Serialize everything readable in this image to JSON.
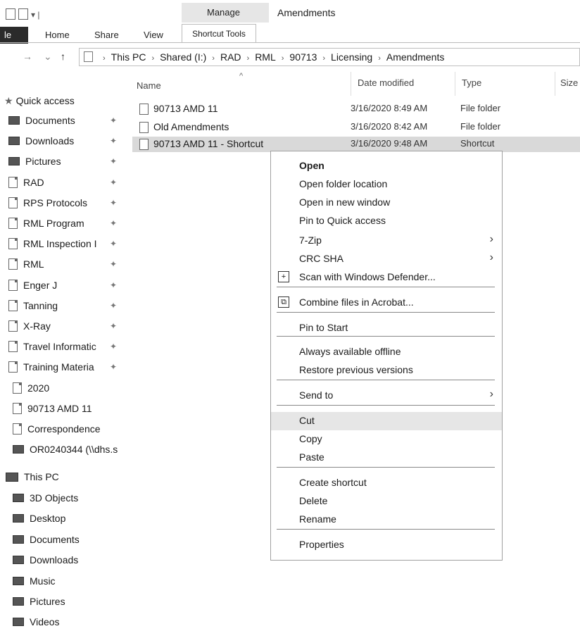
{
  "ribbon": {
    "context_header": "Manage",
    "window_title": "Amendments",
    "tabs": [
      "le",
      "Home",
      "Share",
      "View"
    ],
    "active_tool_tab": "Shortcut Tools"
  },
  "address": {
    "crumbs": [
      "This PC",
      "Shared (I:)",
      "RAD",
      "RML",
      "90713",
      "Licensing",
      "Amendments"
    ]
  },
  "columns": {
    "name": "Name",
    "date": "Date modified",
    "type": "Type",
    "size": "Size"
  },
  "sidebar": {
    "quick_access": "Quick access",
    "pinned": [
      {
        "label": "Documents",
        "icon": "documents-icon"
      },
      {
        "label": "Downloads",
        "icon": "downloads-icon"
      },
      {
        "label": "Pictures",
        "icon": "pictures-icon"
      },
      {
        "label": "RAD",
        "icon": "shortcut-icon"
      },
      {
        "label": "RPS Protocols",
        "icon": "folder-icon"
      },
      {
        "label": "RML Program",
        "icon": "folder-icon"
      },
      {
        "label": "RML Inspection I",
        "icon": "folder-icon"
      },
      {
        "label": "RML",
        "icon": "folder-icon"
      },
      {
        "label": "Enger J",
        "icon": "folder-icon"
      },
      {
        "label": "Tanning",
        "icon": "folder-icon"
      },
      {
        "label": "X-Ray",
        "icon": "folder-icon"
      },
      {
        "label": "Travel Informatic",
        "icon": "folder-icon"
      },
      {
        "label": "Training Materia",
        "icon": "folder-icon"
      }
    ],
    "recent": [
      {
        "label": "2020",
        "icon": "folder-icon"
      },
      {
        "label": "90713 AMD 11",
        "icon": "folder-icon"
      },
      {
        "label": "Correspondence",
        "icon": "folder-icon"
      },
      {
        "label": "OR0240344 (\\\\dhs.s",
        "icon": "network-drive-icon"
      }
    ],
    "this_pc": "This PC",
    "pc_items": [
      {
        "label": "3D Objects",
        "icon": "3d-objects-icon"
      },
      {
        "label": "Desktop",
        "icon": "desktop-icon"
      },
      {
        "label": "Documents",
        "icon": "documents-icon"
      },
      {
        "label": "Downloads",
        "icon": "downloads-icon"
      },
      {
        "label": "Music",
        "icon": "music-icon"
      },
      {
        "label": "Pictures",
        "icon": "pictures-icon"
      },
      {
        "label": "Videos",
        "icon": "videos-icon"
      }
    ]
  },
  "files": [
    {
      "name": "90713 AMD 11",
      "date": "3/16/2020 8:49 AM",
      "type": "File folder"
    },
    {
      "name": "Old Amendments",
      "date": "3/16/2020 8:42 AM",
      "type": "File folder"
    },
    {
      "name": "90713 AMD 11 - Shortcut",
      "date": "3/16/2020 9:48 AM",
      "type": "Shortcut"
    }
  ],
  "context_menu": {
    "items": [
      {
        "label": "Open",
        "bold": true
      },
      {
        "label": "Open folder location"
      },
      {
        "label": "Open in new window"
      },
      {
        "label": "Pin to Quick access"
      },
      {
        "label": "7-Zip",
        "submenu": true
      },
      {
        "label": "CRC SHA",
        "submenu": true
      },
      {
        "label": "Scan with Windows Defender...",
        "icon": "defender-icon"
      },
      {
        "label": "Combine files in Acrobat...",
        "icon": "acrobat-icon"
      },
      {
        "label": "Pin to Start"
      },
      {
        "label": "Always available offline"
      },
      {
        "label": "Restore previous versions"
      },
      {
        "label": "Send to",
        "submenu": true
      },
      {
        "label": "Cut",
        "highlighted": true
      },
      {
        "label": "Copy"
      },
      {
        "label": "Paste"
      },
      {
        "label": "Create shortcut"
      },
      {
        "label": "Delete"
      },
      {
        "label": "Rename"
      },
      {
        "label": "Properties"
      }
    ]
  }
}
